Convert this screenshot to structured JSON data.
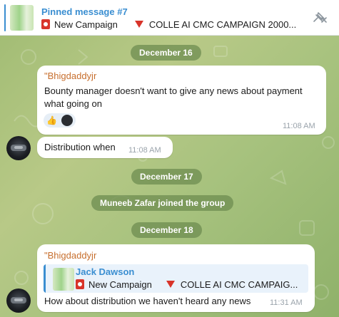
{
  "pinned": {
    "title": "Pinned message #7",
    "preview_part1": "New Campaign",
    "preview_part2": "COLLE AI CMC CAMPAIGN 2000..."
  },
  "dates": {
    "d1": "December 16",
    "d2": "December 17",
    "d3": "December 18"
  },
  "service": {
    "joined": "Muneeb Zafar joined the group"
  },
  "messages": [
    {
      "sender": "\"Bhigdaddyjr",
      "text_line1": "Bounty manager doesn't want to give any news about payment",
      "text_line2": "what going on",
      "time": "11:08 AM",
      "reaction_emoji": "👍"
    },
    {
      "text": "Distribution when",
      "time": "11:08 AM"
    },
    {
      "sender": "\"Bhigdaddyjr",
      "reply_name": "Jack Dawson",
      "reply_part1": "New Campaign",
      "reply_part2": "COLLE AI CMC CAMPAIG...",
      "text": "How about distribution we haven't heard any news",
      "time": "11:31 AM"
    }
  ],
  "icons": {
    "unpin": "unpin-icon",
    "campaign": "red-badge-icon",
    "arrow": "red-triangle-down-icon"
  }
}
